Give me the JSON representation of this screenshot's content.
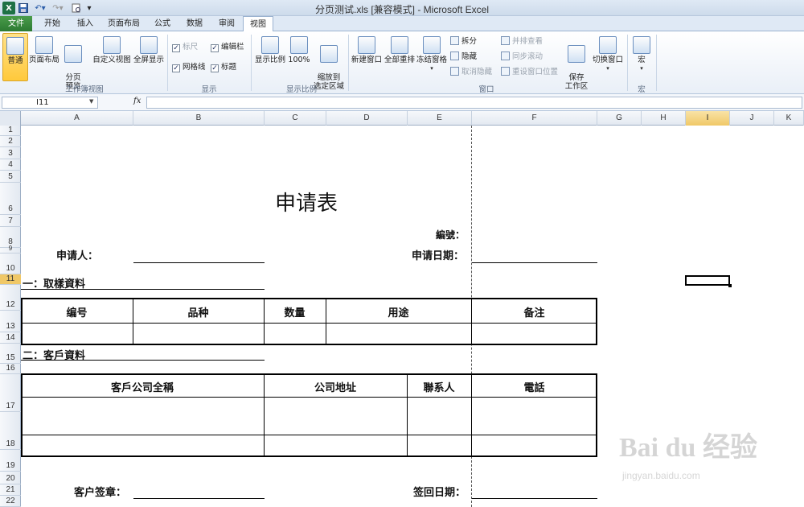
{
  "titlebar": {
    "app_icon": "X",
    "title": "分页测试.xls  [兼容模式] - Microsoft Excel",
    "quick_access": [
      "save-icon",
      "undo-icon",
      "redo-icon",
      "print-preview-icon",
      "customize-icon"
    ]
  },
  "tabs": [
    "文件",
    "开始",
    "插入",
    "页面布局",
    "公式",
    "数据",
    "审阅",
    "视图"
  ],
  "active_tab": "视图",
  "ribbon": {
    "workbook_views": {
      "label": "工作簿视图",
      "normal": "普通",
      "page_layout": "页面布局",
      "page_break_preview": "分页\n预览",
      "custom_views": "自定义视图",
      "full_screen": "全屏显示"
    },
    "show": {
      "label": "显示",
      "ruler": "标尺",
      "gridlines": "网格线",
      "formula_bar": "编辑栏",
      "headings": "标题"
    },
    "zoom": {
      "label": "显示比例",
      "zoom": "显示比例",
      "hundred": "100%",
      "zoom_to_selection": "缩放到\n选定区域"
    },
    "window": {
      "label": "窗口",
      "new_window": "新建窗口",
      "arrange_all": "全部重排",
      "freeze_panes": "冻结窗格",
      "split": "拆分",
      "hide": "隐藏",
      "unhide": "取消隐藏",
      "side_by_side": "并排查看",
      "sync_scroll": "同步滚动",
      "reset_position": "重设窗口位置",
      "save_workspace": "保存\n工作区",
      "switch_windows": "切换窗口"
    },
    "macros": {
      "label": "宏",
      "macros": "宏"
    }
  },
  "formula_bar": {
    "name_box": "I11",
    "fx": "fx",
    "value": ""
  },
  "columns": [
    "A",
    "B",
    "C",
    "D",
    "E",
    "F",
    "G",
    "H",
    "I",
    "J",
    "K"
  ],
  "selected_column": "I",
  "rows": [
    "1",
    "2",
    "3",
    "4",
    "5",
    "6",
    "7",
    "8",
    "9",
    "10",
    "11",
    "12",
    "13",
    "14",
    "15",
    "16",
    "17",
    "18",
    "19",
    "20",
    "21",
    "22"
  ],
  "form": {
    "title": "申请表",
    "number_label": "編號：",
    "applicant_label": "申请人：",
    "apply_date_label": "申请日期：",
    "section1": "一：取樣資料",
    "table1_headers": [
      "编号",
      "品种",
      "数量",
      "用途",
      "备注"
    ],
    "section2": "二：客戶資料",
    "table2_headers": [
      "客戶公司全稱",
      "公司地址",
      "聯系人",
      "電話"
    ],
    "customer_stamp_label": "客户签章：",
    "return_date_label": "签回日期："
  },
  "watermark": {
    "brand": "Bai du 经验",
    "url": "jingyan.baidu.com"
  }
}
